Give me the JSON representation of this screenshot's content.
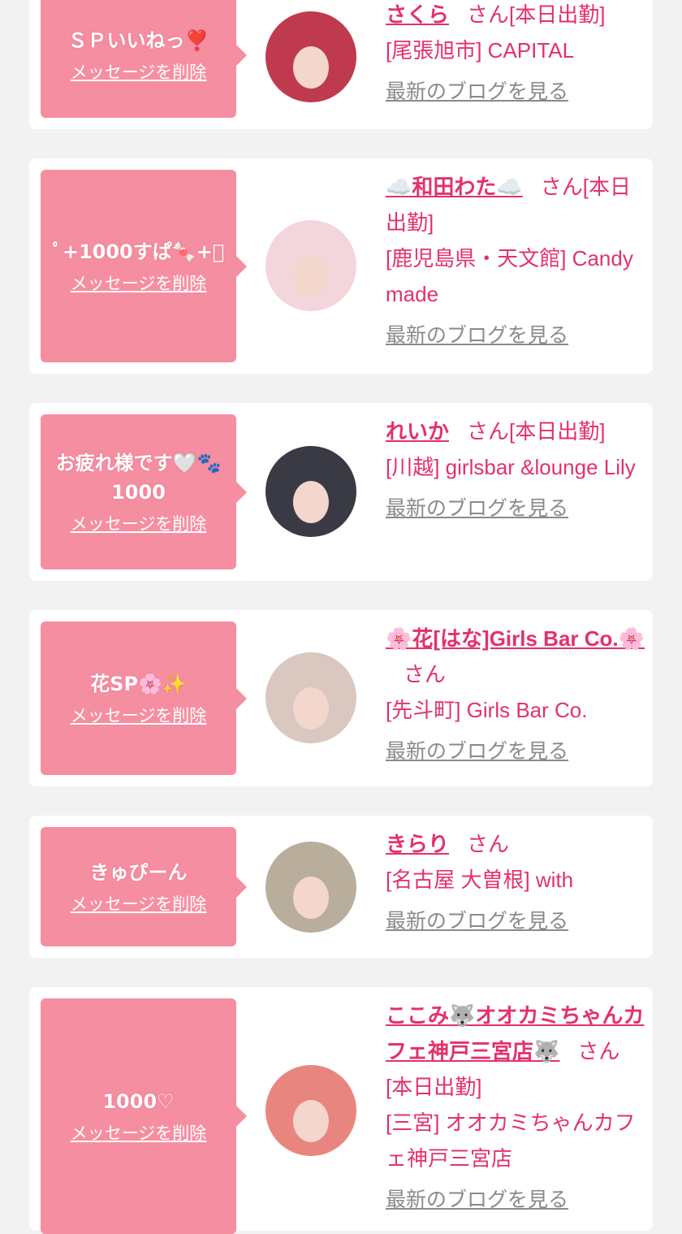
{
  "cards": [
    {
      "message": "ＳＰいいねっ❣️",
      "delete_label": "メッセージを削除",
      "name": "さくら",
      "suffix": "さん",
      "status": "[本日出勤]",
      "area": "[尾張旭市] CAPITAL",
      "blog_label": "最新のブログを見る",
      "avatar_color": "#c03a4f"
    },
    {
      "message": "ﾟ+1000すぱ🍬+ﾟ",
      "delete_label": "メッセージを削除",
      "name": "☁️和田わた☁️",
      "suffix": "さん",
      "status": "[本日出勤]",
      "area": "[鹿児島県・天文館] Candy made",
      "blog_label": "最新のブログを見る",
      "avatar_color": "#f2d6dc"
    },
    {
      "message": "お疲れ様です🤍🐾1000",
      "delete_label": "メッセージを削除",
      "name": "れいか",
      "suffix": "さん",
      "status": "[本日出勤]",
      "area": "[川越] girlsbar &lounge Lily",
      "blog_label": "最新のブログを見る",
      "avatar_color": "#3a3a44"
    },
    {
      "message": "花SP🌸✨",
      "delete_label": "メッセージを削除",
      "name": "🌸花[はな]Girls Bar Co.🌸",
      "suffix": "さん",
      "status": "",
      "area": "[先斗町] Girls Bar Co.",
      "blog_label": "最新のブログを見る",
      "avatar_color": "#d9c7c0"
    },
    {
      "message": "きゅぴーん",
      "delete_label": "メッセージを削除",
      "name": "きらり",
      "suffix": "さん",
      "status": "",
      "area": "[名古屋 大曽根] with",
      "blog_label": "最新のブログを見る",
      "avatar_color": "#b9ad9c"
    },
    {
      "message": "1000♡",
      "delete_label": "メッセージを削除",
      "name": "ここみ🐺オオカミちゃんカフェ神戸三宮店🐺",
      "suffix": "さん",
      "status": "[本日出勤]",
      "area": "[三宮] オオカミちゃんカフェ神戸三宮店",
      "blog_label": "最新のブログを見る",
      "avatar_color": "#e9857f"
    }
  ]
}
